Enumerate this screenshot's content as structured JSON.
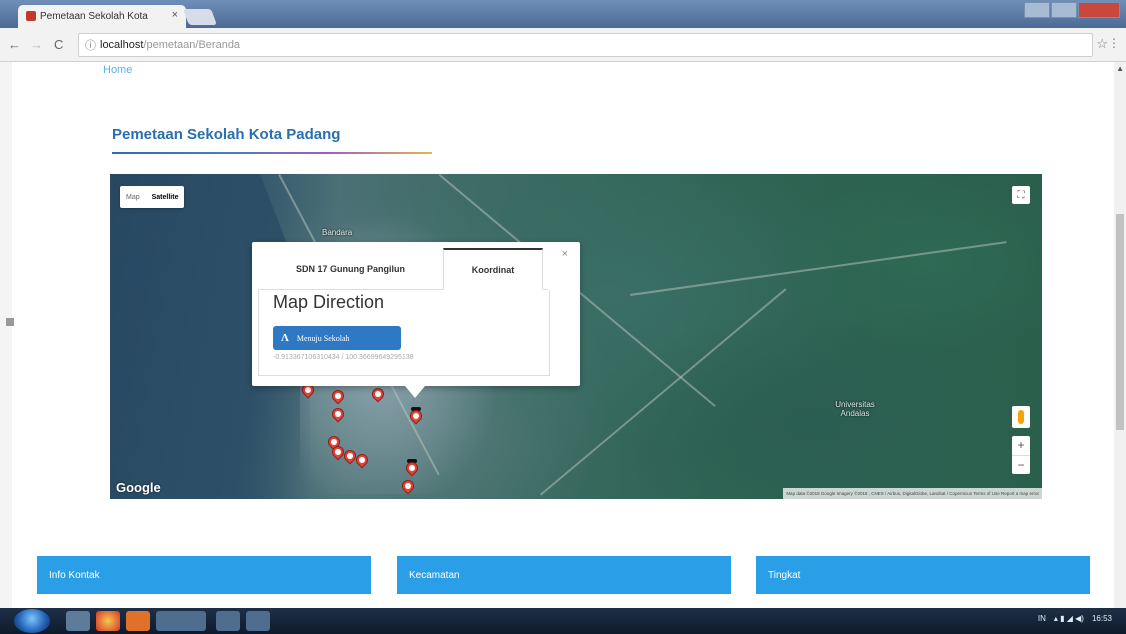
{
  "browser": {
    "tab_title": "Pemetaan Sekolah Kota",
    "tab_close": "×",
    "url_host": "localhost",
    "url_path": "/pemetaan/Beranda",
    "back_icon": "back-arrow-icon",
    "forward_icon": "forward-arrow-icon",
    "reload_icon": "reload-icon",
    "info_icon": "info-icon",
    "bookmark_icon": "star-icon",
    "menu_icon": "kebab-menu-icon"
  },
  "breadcrumb": {
    "home": "Home"
  },
  "page": {
    "title": "Pemetaan Sekolah Kota Padang"
  },
  "map": {
    "type_map": "Map",
    "type_satellite": "Satellite",
    "google": "Google",
    "attribution": "Map data ©2018 Google Imagery ©2018 , CNES / Airbus, DigitalGlobe, Landsat / Copernicus   Terms of Use   Report a map error",
    "labels": {
      "bandara": "Bandara",
      "universitas": "Universitas Andalas"
    },
    "zoom_in": "+",
    "zoom_out": "−"
  },
  "infowindow": {
    "tab_school": "SDN 17 Gunung Pangilun",
    "tab_coord": "Koordinat",
    "close": "×",
    "heading": "Map Direction",
    "button_label": "Menuju Sekolah",
    "coordinates": "-0.913367106310434 / 100.36699649295138"
  },
  "cards": [
    {
      "label": "Info Kontak"
    },
    {
      "label": "Kecamatan"
    },
    {
      "label": "Tingkat"
    }
  ],
  "taskbar": {
    "time": "16:53",
    "lang": "IN"
  },
  "colors": {
    "accent": "#2a9fe8",
    "title": "#2a6fae",
    "button": "#2f78c4",
    "marker": "#e0463a"
  }
}
